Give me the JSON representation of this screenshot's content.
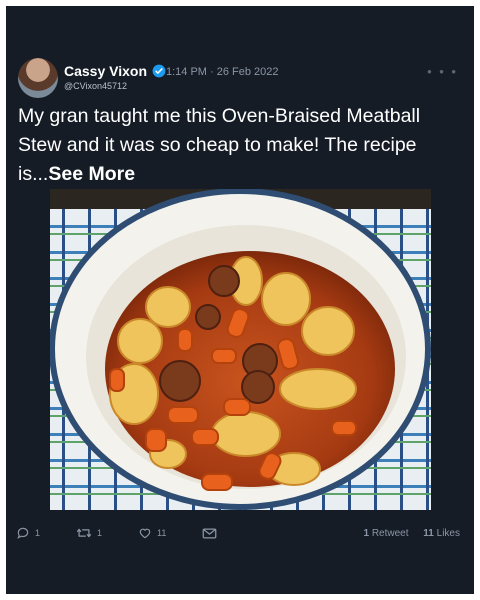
{
  "tweet": {
    "display_name": "Cassy Vixon",
    "handle": "@CVixon45712",
    "timestamp": "1:14 PM · 26 Feb 2022",
    "more_icon": "• • •",
    "text": "My gran taught me this Oven-Braised Meatball Stew and it was so cheap to make! The recipe is...",
    "see_more": "See More",
    "image_alt": "Oven-braised meatball stew with potatoes and carrots in a white cast iron pot",
    "verified_color": "#1d9bf0"
  },
  "actions": {
    "reply_count": "1",
    "retweet_count": "1",
    "like_count": "11",
    "share_icon": "mail-icon"
  },
  "stats": {
    "retweets_value": "1",
    "retweets_label": "Retweet",
    "likes_value": "11",
    "likes_label": "Likes"
  },
  "colors": {
    "background": "#151c26",
    "text": "#ffffff",
    "secondary": "#8b96a5"
  }
}
